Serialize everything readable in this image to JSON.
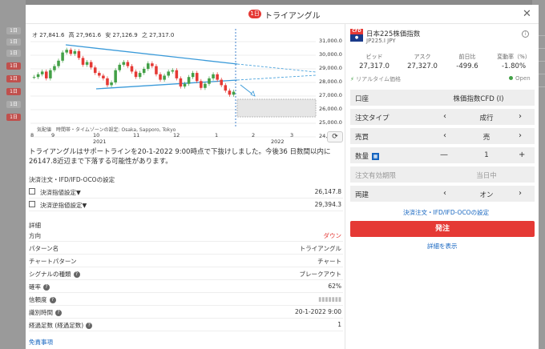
{
  "background": {
    "badges": [
      "1日",
      "1日",
      "1日",
      "1日",
      "1日",
      "1日",
      "1日",
      "1日"
    ]
  },
  "header": {
    "badge": "1日",
    "title": "トライアングル"
  },
  "chart": {
    "ohlc": {
      "open": "オ 27,841.6",
      "high": "高 27,961.6",
      "low": "安 27,126.9",
      "close": "之 27,317.0"
    },
    "note": "気配値　時間帯・タイムゾーンの設定: Osaka, Sapporo, Tokyo",
    "refresh_icon": "refresh-icon"
  },
  "chart_data": {
    "type": "line",
    "y_ticks": [
      "31,000.0",
      "30,000.0",
      "29,000.0",
      "28,000.0",
      "27,000.0",
      "26,000.0",
      "25,000.0",
      "24,000.0"
    ],
    "x_ticks_top": [
      "8",
      "9",
      "10",
      "11",
      "12",
      "1",
      "2",
      "3"
    ],
    "x_ticks_bottom": [
      "2021",
      "2022"
    ],
    "ylim": [
      24000,
      31000
    ],
    "series": [
      {
        "values": [
          28400,
          28600,
          28800,
          28300,
          28900,
          29200,
          29600,
          30200,
          30400,
          30100,
          30300,
          29800,
          29300,
          29500,
          29100,
          28700,
          28500,
          28300,
          27800,
          28000,
          28900,
          29300,
          29500,
          29200,
          28800,
          28400,
          28700,
          29000,
          29400,
          29200,
          28600,
          28200,
          28500,
          28800,
          28900,
          28300,
          27700,
          27900,
          28400,
          28700,
          28100,
          27600,
          27900,
          28300,
          28600,
          28200,
          27800,
          27400,
          27100,
          27317
        ]
      }
    ]
  },
  "description": "トライアングルはサポートラインを20-1-2022 9:00時点で下抜けしました。今後36 日数間以内に26147.8近辺まで下落する可能性があります。",
  "settlement": {
    "title": "決済注文・IFD/IFD-OCOの設定",
    "take_profit_label": "決済指値設定▼",
    "take_profit_value": "26,147.8",
    "stop_loss_label": "決済逆指値設定▼",
    "stop_loss_value": "29,394.3"
  },
  "details": {
    "title": "詳細",
    "rows": [
      {
        "label": "方向",
        "value": "ダウン"
      },
      {
        "label": "パターン名",
        "value": "トライアングル"
      },
      {
        "label": "チャートパターン",
        "value": "チャート"
      },
      {
        "label": "シグナルの種類",
        "value": "ブレークアウト"
      },
      {
        "label": "確率",
        "value": "62%"
      },
      {
        "label": "信頼度",
        "value": "▮▮▮▮▮▮▮"
      },
      {
        "label": "識別時間",
        "value": "20-1-2022 9:00"
      },
      {
        "label": "経過足数 (経過足数)",
        "value": "1"
      }
    ],
    "disclaimer": "免責事項"
  },
  "product": {
    "icon_top": "CFD",
    "icon_bottom": "●",
    "name": "日本225株価指数",
    "code": "JP225.I JPY",
    "info_icon": "i"
  },
  "quote": {
    "bid_label": "ビッド",
    "ask_label": "アスク",
    "change_label": "前日比",
    "rate_label": "変動率（%）",
    "bid": "27,317.0",
    "ask": "27,327.0",
    "change": "-499.6",
    "rate": "-1.80%",
    "realtime": "リアルタイム価格",
    "status": "Open"
  },
  "form": {
    "account_label": "口座",
    "account_value": "株価指数CFD (I)",
    "order_type_label": "注文タイプ",
    "order_type_value": "成行",
    "side_label": "売買",
    "side_value": "売",
    "qty_label": "数量",
    "qty_value": "1",
    "qty_minus": "—",
    "qty_plus": "+",
    "expiry_label": "注文有効期限",
    "expiry_value": "当日中",
    "both_label": "両建",
    "both_value": "オン",
    "settle_link": "決済注文・IFD/IFD-OCOの設定",
    "order_button": "発注",
    "detail_link": "詳細を表示"
  }
}
